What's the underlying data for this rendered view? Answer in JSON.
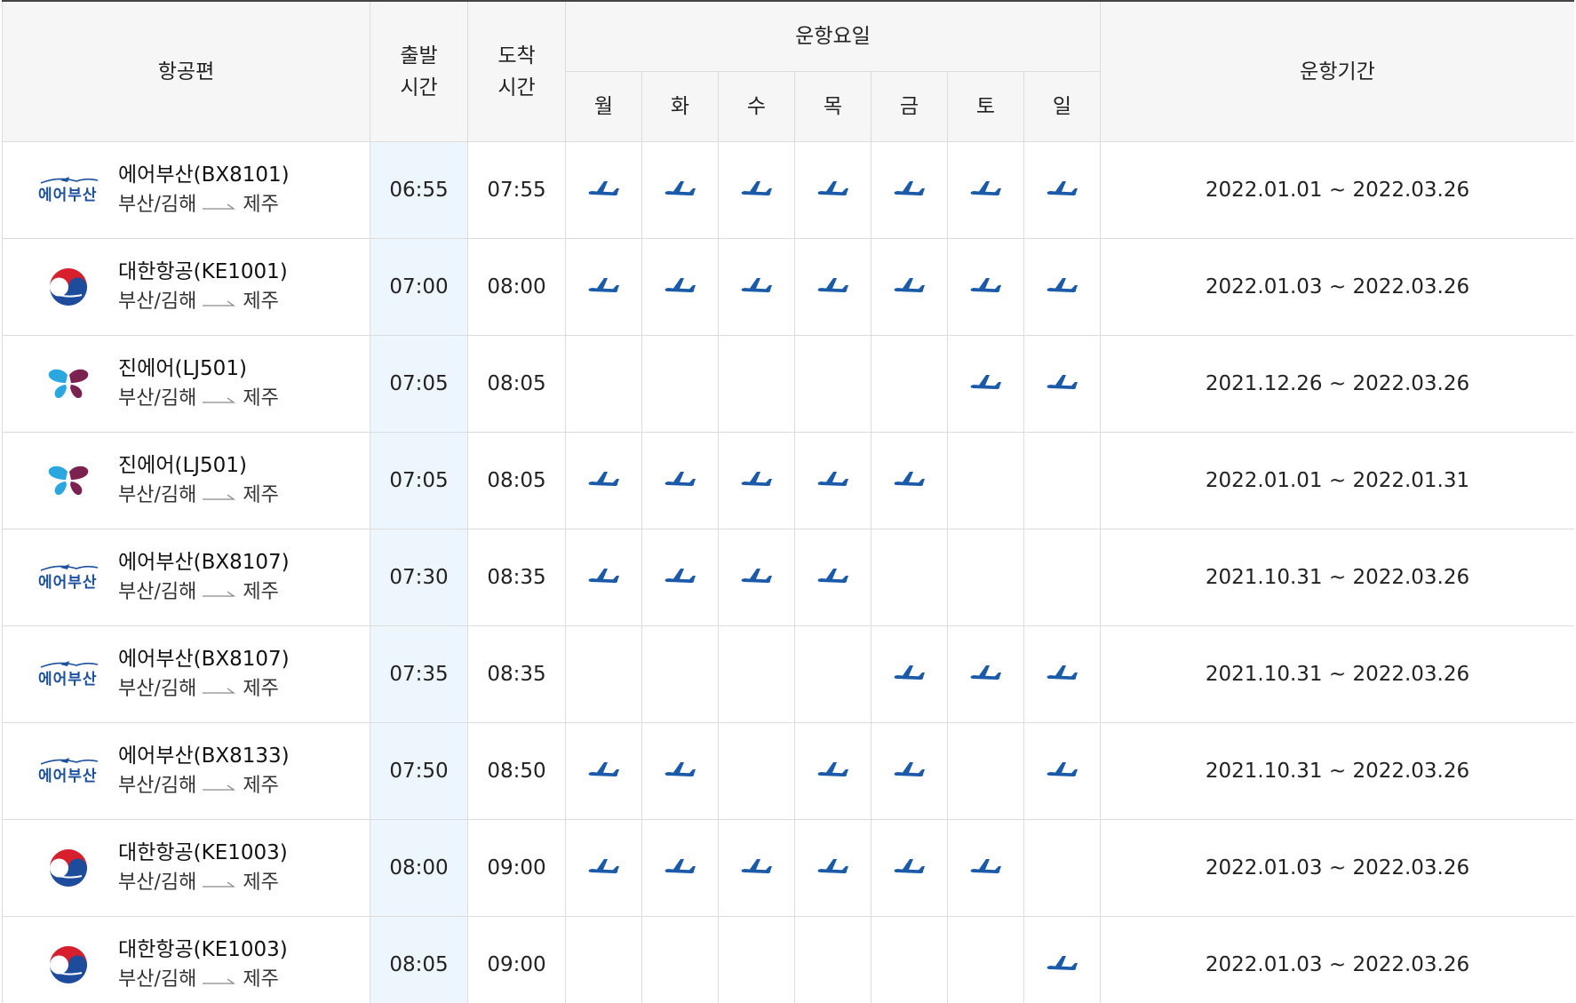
{
  "header": {
    "flight": "항공편",
    "departure_line1": "출발",
    "departure_line2": "시간",
    "arrival_line1": "도착",
    "arrival_line2": "시간",
    "operating_days": "운항요일",
    "period": "운항기간",
    "days": [
      "월",
      "화",
      "수",
      "목",
      "금",
      "토",
      "일"
    ]
  },
  "route": {
    "from": "부산/김해",
    "to": "제주"
  },
  "colors": {
    "plane": "#1a5aa8",
    "airbusan": "#1c4f9c",
    "header_bg": "#f6f6f6",
    "dep_bg": "#eef6fd"
  },
  "rows": [
    {
      "airline_logo": "airbusan-logo",
      "flight": "에어부산(BX8101)",
      "dep": "06:55",
      "arr": "07:55",
      "days": [
        1,
        1,
        1,
        1,
        1,
        1,
        1
      ],
      "period": "2022.01.01 ~ 2022.03.26"
    },
    {
      "airline_logo": "koreanair-logo",
      "flight": "대한항공(KE1001)",
      "dep": "07:00",
      "arr": "08:00",
      "days": [
        1,
        1,
        1,
        1,
        1,
        1,
        1
      ],
      "period": "2022.01.03 ~ 2022.03.26"
    },
    {
      "airline_logo": "jinair-logo",
      "flight": "진에어(LJ501)",
      "dep": "07:05",
      "arr": "08:05",
      "days": [
        0,
        0,
        0,
        0,
        0,
        1,
        1
      ],
      "period": "2021.12.26 ~ 2022.03.26"
    },
    {
      "airline_logo": "jinair-logo",
      "flight": "진에어(LJ501)",
      "dep": "07:05",
      "arr": "08:05",
      "days": [
        1,
        1,
        1,
        1,
        1,
        0,
        0
      ],
      "period": "2022.01.01 ~ 2022.01.31"
    },
    {
      "airline_logo": "airbusan-logo",
      "flight": "에어부산(BX8107)",
      "dep": "07:30",
      "arr": "08:35",
      "days": [
        1,
        1,
        1,
        1,
        0,
        0,
        0
      ],
      "period": "2021.10.31 ~ 2022.03.26"
    },
    {
      "airline_logo": "airbusan-logo",
      "flight": "에어부산(BX8107)",
      "dep": "07:35",
      "arr": "08:35",
      "days": [
        0,
        0,
        0,
        0,
        1,
        1,
        1
      ],
      "period": "2021.10.31 ~ 2022.03.26"
    },
    {
      "airline_logo": "airbusan-logo",
      "flight": "에어부산(BX8133)",
      "dep": "07:50",
      "arr": "08:50",
      "days": [
        1,
        1,
        0,
        1,
        1,
        0,
        1
      ],
      "period": "2021.10.31 ~ 2022.03.26"
    },
    {
      "airline_logo": "koreanair-logo",
      "flight": "대한항공(KE1003)",
      "dep": "08:00",
      "arr": "09:00",
      "days": [
        1,
        1,
        1,
        1,
        1,
        1,
        0
      ],
      "period": "2022.01.03 ~ 2022.03.26"
    },
    {
      "airline_logo": "koreanair-logo",
      "flight": "대한항공(KE1003)",
      "dep": "08:05",
      "arr": "09:00",
      "days": [
        0,
        0,
        0,
        0,
        0,
        0,
        1
      ],
      "period": "2022.01.03 ~ 2022.03.26"
    }
  ],
  "logos": {
    "airbusan_text": "에어부산"
  }
}
